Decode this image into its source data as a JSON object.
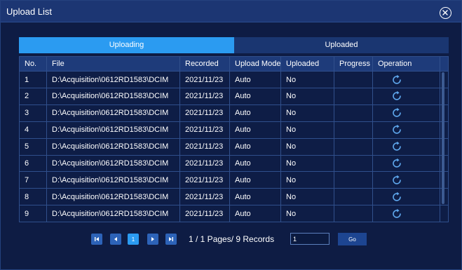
{
  "dialog": {
    "title": "Upload List",
    "close_icon": "close-circle-icon"
  },
  "tabs": [
    {
      "label": "Uploading",
      "active": true
    },
    {
      "label": "Uploaded",
      "active": false
    }
  ],
  "table": {
    "headers": {
      "no": "No.",
      "file": "File",
      "recorded": "Recorded",
      "upload_mode": "Upload Mode",
      "uploaded": "Uploaded",
      "progress": "Progress",
      "operation": "Operation"
    },
    "rows": [
      {
        "no": "1",
        "file": "D:\\Acquisition\\0612RD1583\\DCIM",
        "recorded": "2021/11/23",
        "upload_mode": "Auto",
        "uploaded": "No",
        "progress": "",
        "operation_icon": "refresh-icon"
      },
      {
        "no": "2",
        "file": "D:\\Acquisition\\0612RD1583\\DCIM",
        "recorded": "2021/11/23",
        "upload_mode": "Auto",
        "uploaded": "No",
        "progress": "",
        "operation_icon": "refresh-icon"
      },
      {
        "no": "3",
        "file": "D:\\Acquisition\\0612RD1583\\DCIM",
        "recorded": "2021/11/23",
        "upload_mode": "Auto",
        "uploaded": "No",
        "progress": "",
        "operation_icon": "refresh-icon"
      },
      {
        "no": "4",
        "file": "D:\\Acquisition\\0612RD1583\\DCIM",
        "recorded": "2021/11/23",
        "upload_mode": "Auto",
        "uploaded": "No",
        "progress": "",
        "operation_icon": "refresh-icon"
      },
      {
        "no": "5",
        "file": "D:\\Acquisition\\0612RD1583\\DCIM",
        "recorded": "2021/11/23",
        "upload_mode": "Auto",
        "uploaded": "No",
        "progress": "",
        "operation_icon": "refresh-icon"
      },
      {
        "no": "6",
        "file": "D:\\Acquisition\\0612RD1583\\DCIM",
        "recorded": "2021/11/23",
        "upload_mode": "Auto",
        "uploaded": "No",
        "progress": "",
        "operation_icon": "refresh-icon"
      },
      {
        "no": "7",
        "file": "D:\\Acquisition\\0612RD1583\\DCIM",
        "recorded": "2021/11/23",
        "upload_mode": "Auto",
        "uploaded": "No",
        "progress": "",
        "operation_icon": "refresh-icon"
      },
      {
        "no": "8",
        "file": "D:\\Acquisition\\0612RD1583\\DCIM",
        "recorded": "2021/11/23",
        "upload_mode": "Auto",
        "uploaded": "No",
        "progress": "",
        "operation_icon": "refresh-icon"
      },
      {
        "no": "9",
        "file": "D:\\Acquisition\\0612RD1583\\DCIM",
        "recorded": "2021/11/23",
        "upload_mode": "Auto",
        "uploaded": "No",
        "progress": "",
        "operation_icon": "refresh-icon"
      }
    ]
  },
  "pager": {
    "first_icon": "first-page-icon",
    "prev_icon": "prev-page-icon",
    "current_page": "1",
    "next_icon": "next-page-icon",
    "last_icon": "last-page-icon",
    "summary": "1  /  1 Pages/  9 Records",
    "page_input_value": "1",
    "go_label": "Go"
  },
  "colors": {
    "background": "#0e1c44",
    "titlebar": "#1c3673",
    "active_tab": "#2b9bf1",
    "inactive_tab": "#1a3671",
    "header_row": "#1e3b7a",
    "icon": "#5fa8ee"
  }
}
